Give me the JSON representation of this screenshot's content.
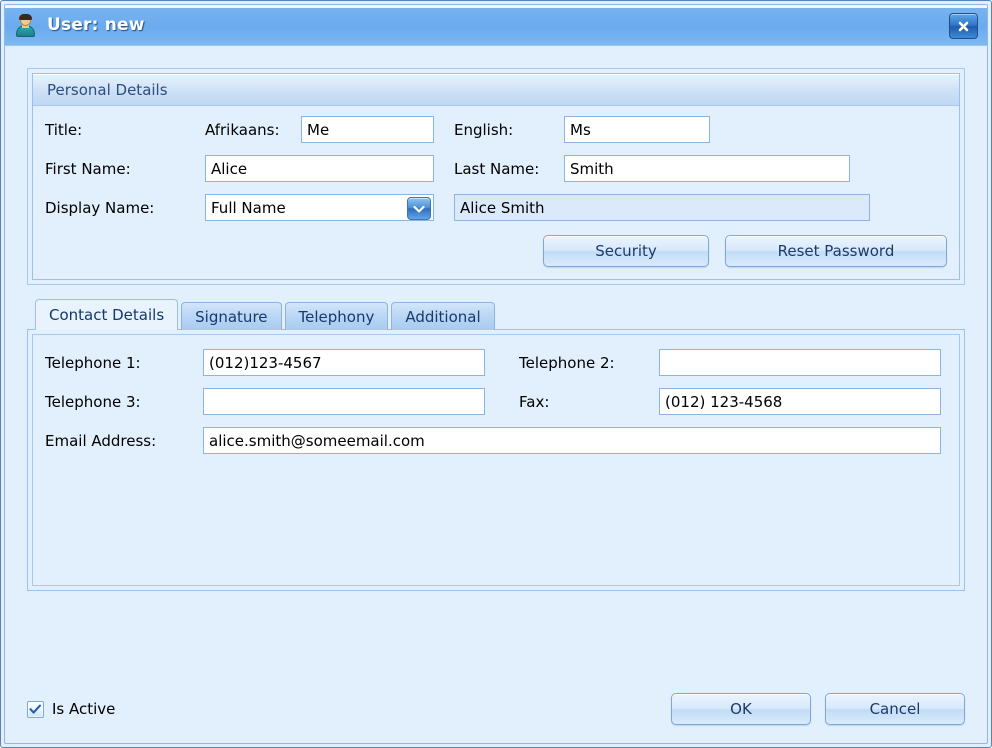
{
  "window": {
    "title": "User: new",
    "user_icon": "user-avatar-icon",
    "close_icon": "close-icon"
  },
  "personal_details": {
    "group_label": "Personal Details",
    "title_label": "Title:",
    "afrikaans_label": "Afrikaans:",
    "afrikaans_value": "Me",
    "english_label": "English:",
    "english_value": "Ms",
    "first_name_label": "First Name:",
    "first_name_value": "Alice",
    "last_name_label": "Last Name:",
    "last_name_value": "Smith",
    "display_name_label": "Display Name:",
    "display_name_selected": "Full Name",
    "display_name_options": [
      "Full Name"
    ],
    "display_name_dropdown_icon": "chevron-down-icon",
    "computed_display_name": "Alice Smith",
    "security_button": "Security",
    "reset_password_button": "Reset Password"
  },
  "tabs": {
    "items": [
      {
        "label": "Contact Details",
        "active": true
      },
      {
        "label": "Signature",
        "active": false
      },
      {
        "label": "Telephony",
        "active": false
      },
      {
        "label": "Additional",
        "active": false
      }
    ]
  },
  "contact_details": {
    "telephone1_label": "Telephone 1:",
    "telephone1_value": "(012)123-4567",
    "telephone2_label": "Telephone 2:",
    "telephone2_value": "",
    "telephone3_label": "Telephone 3:",
    "telephone3_value": "",
    "fax_label": "Fax:",
    "fax_value": "(012) 123-4568",
    "email_label": "Email Address:",
    "email_value": "alice.smith@someemail.com"
  },
  "footer": {
    "is_active_label": "Is Active",
    "is_active_checked": true,
    "check_icon": "checkmark-icon",
    "ok_button": "OK",
    "cancel_button": "Cancel"
  },
  "colors": {
    "titlebar_blue": "#6aabee",
    "panel_bg": "#e2effc",
    "border_blue": "#9cc0e8",
    "accent_text": "#2c4e80"
  }
}
